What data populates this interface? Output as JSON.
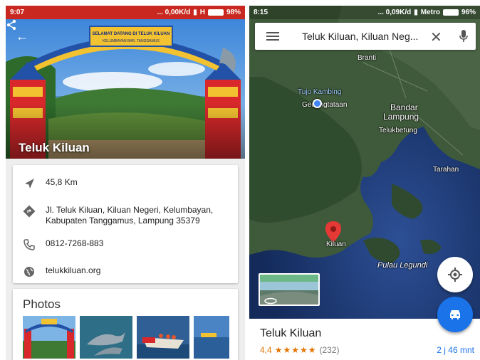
{
  "left": {
    "status": {
      "time": "9:07",
      "net": "... 0,00K/d",
      "carrier": "H",
      "battery": "98%"
    },
    "hero": {
      "gate_text_1": "SELAMAT DATANG DI TELUK KILUAN",
      "gate_text_2": "KELUMBAYAN BAR. TANGGAMUS",
      "title": "Teluk Kiluan"
    },
    "info": {
      "distance": "45,8 Km",
      "address_line1": "Jl. Teluk Kiluan, Kiluan Negeri, Kelumbayan,",
      "address_line2": "Kabupaten Tanggamus, Lampung 35379",
      "phone": "0812-7268-883",
      "website": "telukkiluan.org"
    },
    "photos": {
      "title": "Photos"
    }
  },
  "right": {
    "status": {
      "time": "8:15",
      "net": "... 0,09K/d",
      "carrier": "Metro",
      "battery": "96%"
    },
    "search": {
      "query": "Teluk Kiluan, Kiluan Neg..."
    },
    "map_labels": {
      "branti": "Branti",
      "tulo_kambing": "Tujo Kambing",
      "gedong_tataan": "Gedongtataan",
      "bandar": "Bandar",
      "lampung": "Lampung",
      "telukbetung": "Telukbetung",
      "tarahan": "Tarahan",
      "kiluan": "Kiluan",
      "pulau_legundi": "Pulau Legundi"
    },
    "place": {
      "name": "Teluk Kiluan",
      "rating": "4,4",
      "stars": "★★★★★",
      "reviews": "(232)",
      "eta": "2 j 46 mnt"
    }
  },
  "colors": {
    "status_red": "#c8281f",
    "accent_blue": "#1a73e8",
    "star_orange": "#e37400",
    "pin_red": "#e53935"
  }
}
